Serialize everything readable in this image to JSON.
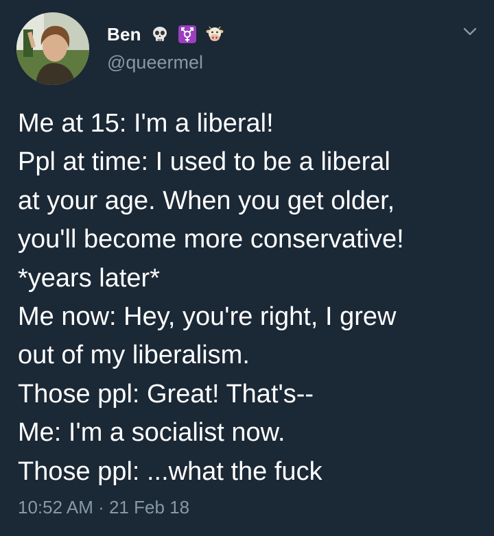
{
  "user": {
    "display_name": "Ben",
    "handle": "@queermel",
    "name_emojis": [
      "skull-emoji",
      "transgender-symbol-emoji",
      "cow-face-emoji"
    ]
  },
  "tweet": {
    "lines": [
      "Me at 15: I'm a liberal!",
      "Ppl at time: I used to be a liberal",
      "at your age. When you get older,",
      "you'll become more conservative!",
      "*years later*",
      "Me now: Hey, you're right, I grew",
      "out of my liberalism.",
      "Those ppl: Great! That's--",
      "Me: I'm a socialist now.",
      "Those ppl: ...what the fuck"
    ],
    "timestamp": "10:52 AM · 21 Feb 18"
  },
  "colors": {
    "background": "#1b2836",
    "text": "#ffffff",
    "secondary_text": "#8899a6",
    "transgender_emoji_bg": "#9b3fbf"
  },
  "icons": {
    "menu": "chevron-down-icon"
  }
}
